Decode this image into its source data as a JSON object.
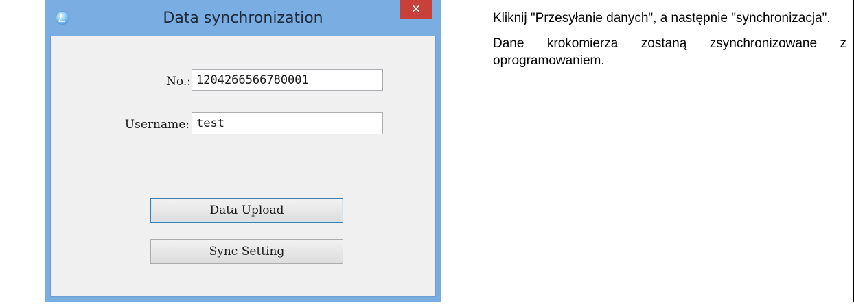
{
  "dialog": {
    "title": "Data synchronization",
    "close_glyph": "×",
    "app_icon": "app-logo-icon",
    "fields": {
      "no_label": "No.:",
      "no_value": "1204266566780001",
      "username_label": "Username:",
      "username_value": "test"
    },
    "buttons": {
      "data_upload": "Data Upload",
      "sync_setting": "Sync Setting"
    }
  },
  "instructions": {
    "paragraph_1": "Kliknij \"Przesyłanie danych\", a następnie \"synchronizacja\".",
    "paragraph_2": "Dane krokomierza zostaną zsynchronizowane z oprogramowaniem."
  },
  "colors": {
    "titlebar": "#7aaee2",
    "close_button": "#c7403a",
    "client_background": "#f0f0f0"
  }
}
